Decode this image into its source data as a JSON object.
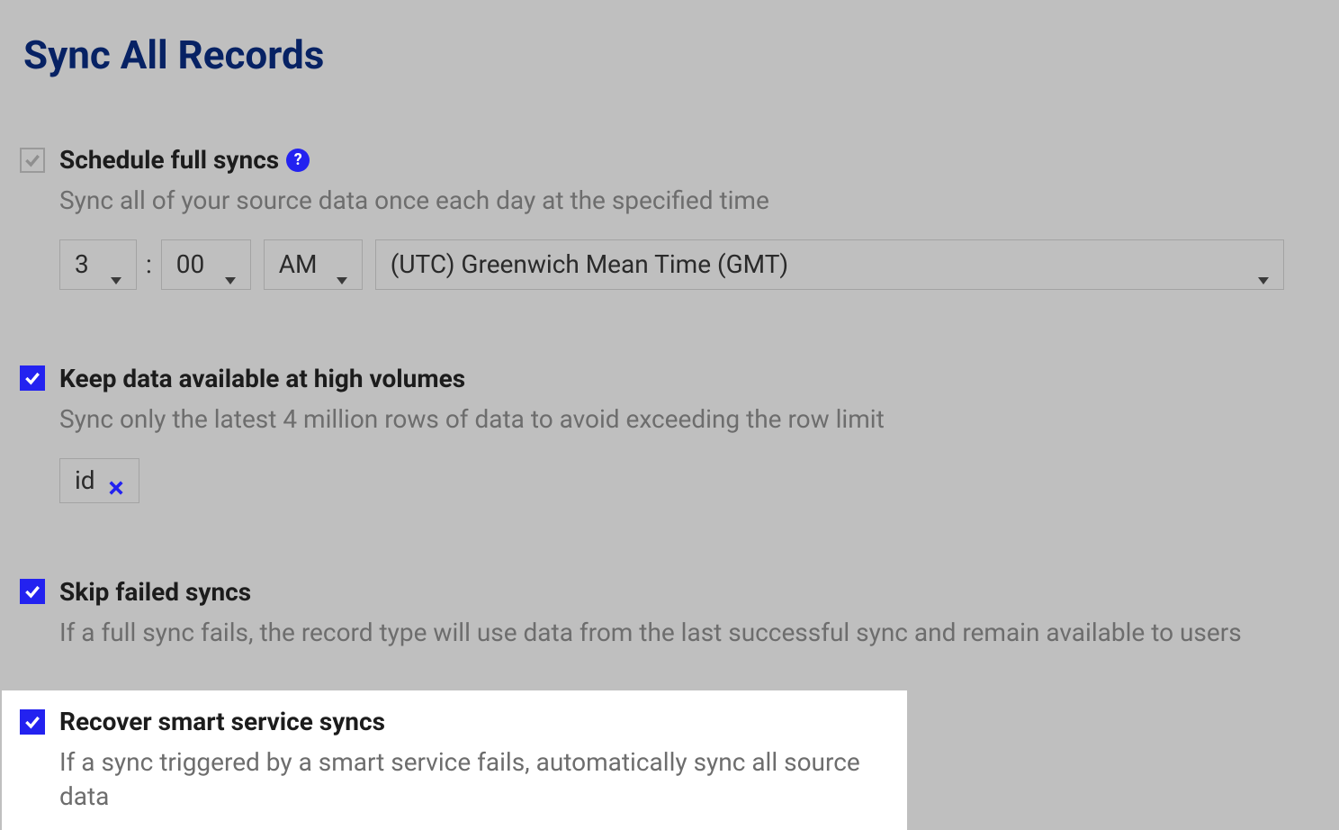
{
  "title": "Sync All Records",
  "sections": {
    "schedule": {
      "label": "Schedule full syncs",
      "desc": "Sync all of your source data once each day at the specified time",
      "hour": "3",
      "minute": "00",
      "ampm": "AM",
      "timezone": "(UTC) Greenwich Mean Time (GMT)"
    },
    "high_volume": {
      "label": "Keep data available at high volumes",
      "desc": "Sync only the latest 4 million rows of data to avoid exceeding the row limit",
      "chip": "id"
    },
    "skip_failed": {
      "label": "Skip failed syncs",
      "desc": "If a full sync fails, the record type will use data from the last successful sync and remain available to users"
    },
    "recover": {
      "label": "Recover smart service syncs",
      "desc": "If a sync triggered by a smart service fails, automatically sync all source data"
    }
  }
}
